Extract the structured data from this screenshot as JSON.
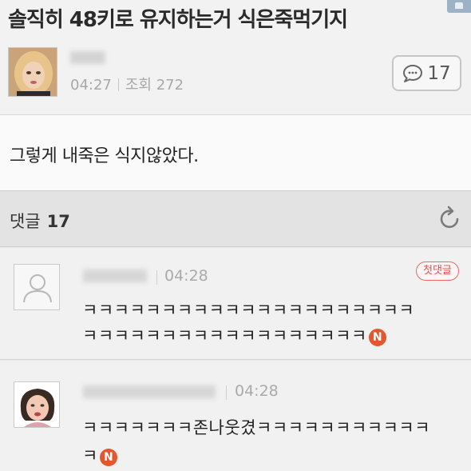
{
  "post": {
    "title": "솔직히 48키로 유지하는거 식은죽먹기지",
    "time": "04:27",
    "views": "조회 272",
    "comment_count": "17",
    "body": "그렇게 내죽은 식지않았다."
  },
  "comments_section": {
    "label": "댓글",
    "count": "17"
  },
  "comments": [
    {
      "time": "04:28",
      "badge": "첫댓글",
      "line1": "ㅋㅋㅋㅋㅋㅋㅋㅋㅋㅋㅋㅋㅋㅋㅋㅋㅋㅋㅋㅋㅋ",
      "line2": "ㅋㅋㅋㅋㅋㅋㅋㅋㅋㅋㅋㅋㅋㅋㅋㅋㅋㅋ",
      "new_badge": "N"
    },
    {
      "time": "04:28",
      "line1": "ㅋㅋㅋㅋㅋㅋㅋ존나웃겼ㅋㅋㅋㅋㅋㅋㅋㅋㅋㅋㅋ",
      "line2": "ㅋ",
      "new_badge": "N"
    }
  ],
  "colors": {
    "new_badge": "#e4572e",
    "first_comment_badge": "#e05050"
  }
}
